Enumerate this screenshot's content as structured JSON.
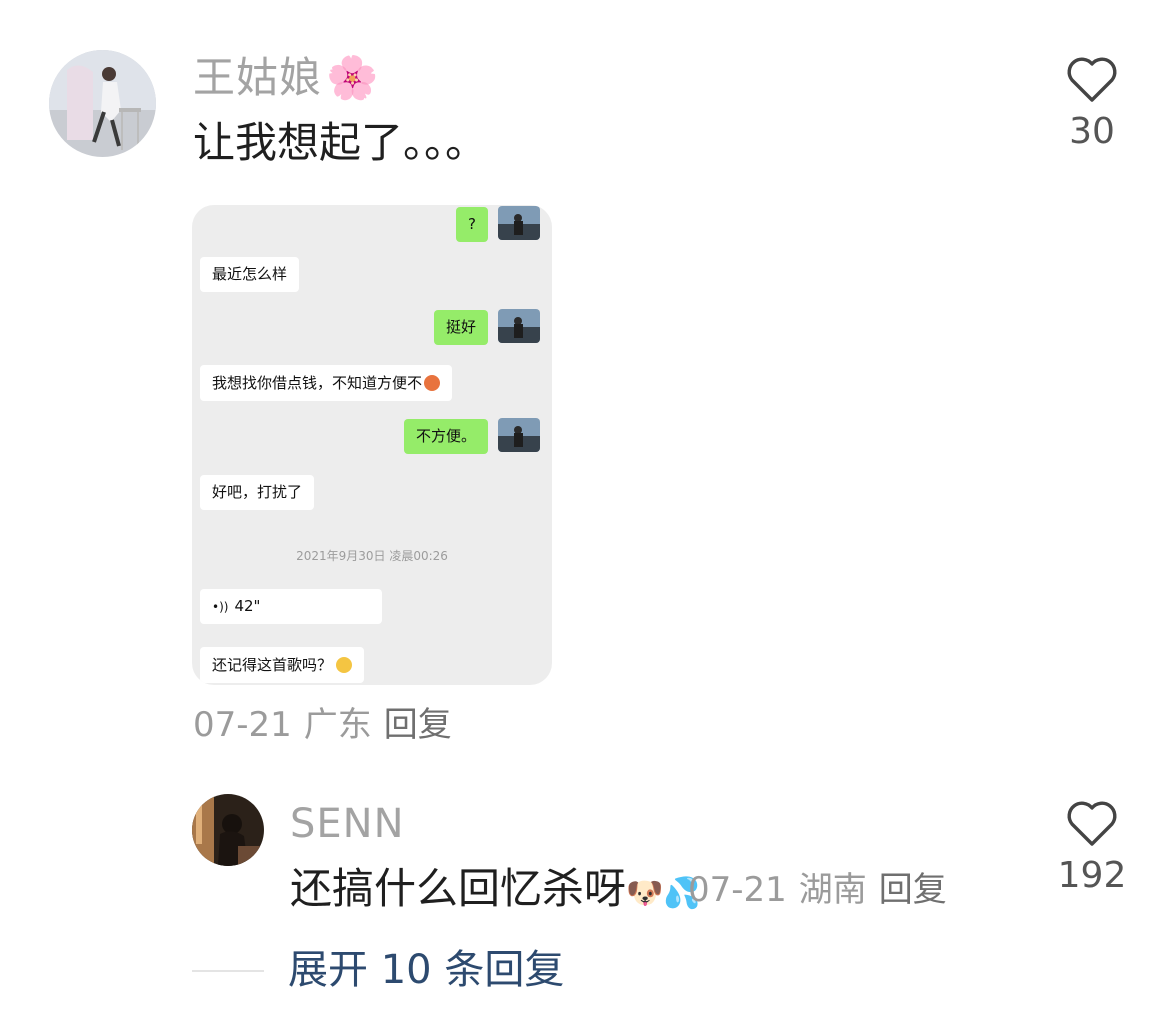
{
  "comments": [
    {
      "username": "王姑娘",
      "username_emoji": "🌸",
      "text": "让我想起了。。。",
      "date": "07-21",
      "location": "广东",
      "reply_label": "回复",
      "like_count": "30",
      "chat_image": {
        "messages": [
          {
            "side": "right",
            "text": "?"
          },
          {
            "side": "left",
            "text": "最近怎么样"
          },
          {
            "side": "right",
            "text": "挺好"
          },
          {
            "side": "left",
            "text": "我想找你借点钱，不知道方便不"
          },
          {
            "side": "right",
            "text": "不方便。"
          },
          {
            "side": "left",
            "text": "好吧，打扰了"
          },
          {
            "side": "left",
            "text": "42\""
          },
          {
            "side": "left",
            "text": "还记得这首歌吗？"
          }
        ],
        "timestamp": "2021年9月30日 凌晨00:26"
      }
    },
    {
      "username": "SENN",
      "text": "还搞什么回忆杀呀",
      "text_emoji": "🐶💦",
      "date": "07-21",
      "location": "湖南",
      "reply_label": "回复",
      "like_count": "192"
    }
  ],
  "expand_replies": "展开 10 条回复",
  "colors": {
    "wechat_green": "#95ec69",
    "expand_link": "#2d4a6f",
    "meta_gray": "#9b9b9b"
  }
}
